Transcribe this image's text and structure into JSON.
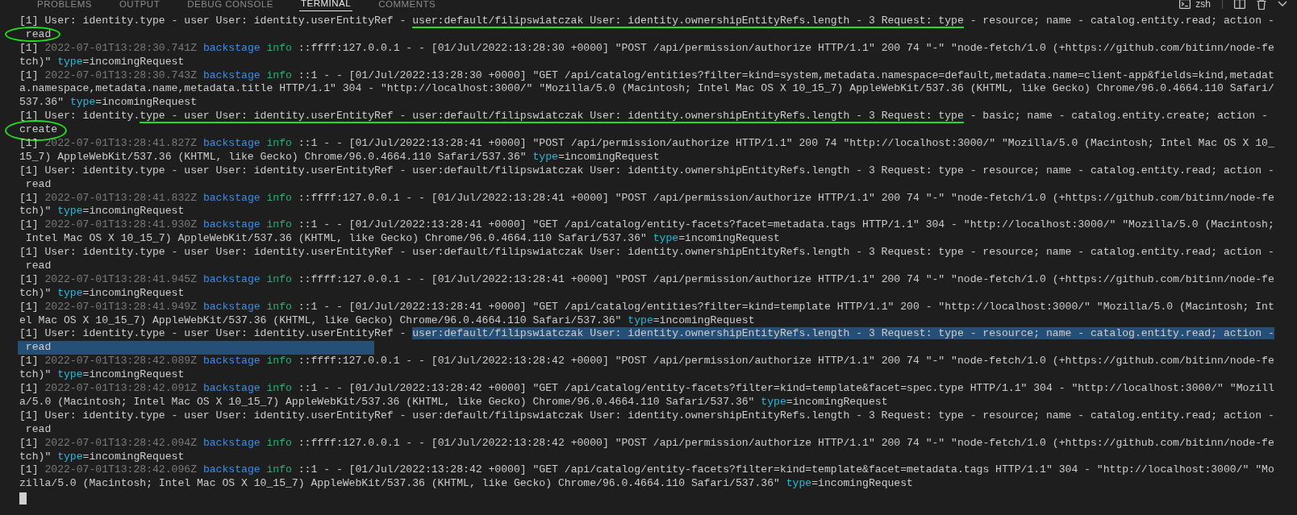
{
  "tabs": [
    {
      "label": "PROBLEMS",
      "selected": false
    },
    {
      "label": "OUTPUT",
      "selected": false
    },
    {
      "label": "DEBUG CONSOLE",
      "selected": false
    },
    {
      "label": "TERMINAL",
      "selected": true
    },
    {
      "label": "COMMENTS",
      "selected": false
    }
  ],
  "shell": {
    "name": "zsh"
  },
  "lines": [
    {
      "segments": [
        {
          "text": "[1] User: identity.type - user User: identity.userEntityRef - ",
          "kind": "plain"
        },
        {
          "text": "user:default/filipswiatczak User: identity.ownershipEntityRefs.length - 3 Request: type",
          "kind": "plain",
          "underlined": true
        },
        {
          "text": " - resource; name - catalog.entity.read; action -",
          "kind": "plain"
        }
      ]
    },
    {
      "segments": [
        {
          "text": " read",
          "kind": "plain",
          "circled": true
        }
      ]
    },
    {
      "segments": [
        {
          "text": "[1] ",
          "kind": "plain"
        },
        {
          "text": "2022-07-01T13:28:30.741Z ",
          "kind": "timestamp"
        },
        {
          "text": "backstage ",
          "kind": "logger"
        },
        {
          "text": "info",
          "kind": "level"
        },
        {
          "text": " ::ffff:127.0.0.1 - - [01/Jul/2022:13:28:30 +0000] \"POST /api/permission/authorize HTTP/1.1\" 200 74 \"-\" \"node-fetch/1.0 (+https://github.com/bitinn/node-fe",
          "kind": "plain"
        }
      ]
    },
    {
      "segments": [
        {
          "text": "tch)\" ",
          "kind": "plain"
        },
        {
          "text": "type",
          "kind": "key"
        },
        {
          "text": "=incomingRequest",
          "kind": "plain"
        }
      ]
    },
    {
      "segments": [
        {
          "text": "[1] ",
          "kind": "plain"
        },
        {
          "text": "2022-07-01T13:28:30.743Z ",
          "kind": "timestamp"
        },
        {
          "text": "backstage ",
          "kind": "logger"
        },
        {
          "text": "info",
          "kind": "level"
        },
        {
          "text": " ::1 - - [01/Jul/2022:13:28:30 +0000] \"GET /api/catalog/entities?filter=kind=system,metadata.namespace=default,metadata.name=client-app&fields=kind,metadat",
          "kind": "plain"
        }
      ]
    },
    {
      "segments": [
        {
          "text": "a.namespace,metadata.name,metadata.title HTTP/1.1\" 304 - \"http://localhost:3000/\" \"Mozilla/5.0 (Macintosh; Intel Mac OS X 10_15_7) AppleWebKit/537.36 (KHTML, like Gecko) Chrome/96.0.4664.110 Safari/",
          "kind": "plain"
        }
      ]
    },
    {
      "segments": [
        {
          "text": "537.36\" ",
          "kind": "plain"
        },
        {
          "text": "type",
          "kind": "key"
        },
        {
          "text": "=incomingRequest",
          "kind": "plain"
        }
      ]
    },
    {
      "segments": [
        {
          "text": "[1] User: identity.",
          "kind": "plain"
        },
        {
          "text": "type - user User: identity.userEntityRef - user:default/filipswiatczak User: identity.ownershipEntityRefs.length - 3 Request: type",
          "kind": "plain",
          "underlined": true
        },
        {
          "text": " - basic; name - catalog.entity.create; action -",
          "kind": "plain"
        }
      ]
    },
    {
      "segments": [
        {
          "text": "create",
          "kind": "plain",
          "circled": true,
          "tall": true
        }
      ]
    },
    {
      "segments": [
        {
          "text": "[1] ",
          "kind": "plain"
        },
        {
          "text": "2022-07-01T13:28:41.827Z ",
          "kind": "timestamp"
        },
        {
          "text": "backstage ",
          "kind": "logger"
        },
        {
          "text": "info",
          "kind": "level"
        },
        {
          "text": " ::1 - - [01/Jul/2022:13:28:41 +0000] \"POST /api/permission/authorize HTTP/1.1\" 200 74 \"http://localhost:3000/\" \"Mozilla/5.0 (Macintosh; Intel Mac OS X 10_",
          "kind": "plain"
        }
      ]
    },
    {
      "segments": [
        {
          "text": "15_7) AppleWebKit/537.36 (KHTML, like Gecko) Chrome/96.0.4664.110 Safari/537.36\" ",
          "kind": "plain"
        },
        {
          "text": "type",
          "kind": "key"
        },
        {
          "text": "=incomingRequest",
          "kind": "plain"
        }
      ]
    },
    {
      "segments": [
        {
          "text": "[1] User: identity.type - user User: identity.userEntityRef - user:default/filipswiatczak User: identity.ownershipEntityRefs.length - 3 Request: type - resource; name - catalog.entity.read; action -",
          "kind": "plain"
        }
      ]
    },
    {
      "segments": [
        {
          "text": " read",
          "kind": "plain"
        }
      ]
    },
    {
      "segments": [
        {
          "text": "[1] ",
          "kind": "plain"
        },
        {
          "text": "2022-07-01T13:28:41.832Z ",
          "kind": "timestamp"
        },
        {
          "text": "backstage ",
          "kind": "logger"
        },
        {
          "text": "info",
          "kind": "level"
        },
        {
          "text": " ::ffff:127.0.0.1 - - [01/Jul/2022:13:28:41 +0000] \"POST /api/permission/authorize HTTP/1.1\" 200 74 \"-\" \"node-fetch/1.0 (+https://github.com/bitinn/node-fe",
          "kind": "plain"
        }
      ]
    },
    {
      "segments": [
        {
          "text": "tch)\" ",
          "kind": "plain"
        },
        {
          "text": "type",
          "kind": "key"
        },
        {
          "text": "=incomingRequest",
          "kind": "plain"
        }
      ]
    },
    {
      "segments": [
        {
          "text": "[1] ",
          "kind": "plain"
        },
        {
          "text": "2022-07-01T13:28:41.930Z ",
          "kind": "timestamp"
        },
        {
          "text": "backstage ",
          "kind": "logger"
        },
        {
          "text": "info",
          "kind": "level"
        },
        {
          "text": " ::1 - - [01/Jul/2022:13:28:41 +0000] \"GET /api/catalog/entity-facets?facet=metadata.tags HTTP/1.1\" 304 - \"http://localhost:3000/\" \"Mozilla/5.0 (Macintosh;",
          "kind": "plain"
        }
      ]
    },
    {
      "segments": [
        {
          "text": " Intel Mac OS X 10_15_7) AppleWebKit/537.36 (KHTML, like Gecko) Chrome/96.0.4664.110 Safari/537.36\" ",
          "kind": "plain"
        },
        {
          "text": "type",
          "kind": "key"
        },
        {
          "text": "=incomingRequest",
          "kind": "plain"
        }
      ]
    },
    {
      "segments": [
        {
          "text": "[1] User: identity.type - user User: identity.userEntityRef - user:default/filipswiatczak User: identity.ownershipEntityRefs.length - 3 Request: type - resource; name - catalog.entity.read; action -",
          "kind": "plain"
        }
      ]
    },
    {
      "segments": [
        {
          "text": " read",
          "kind": "plain"
        }
      ]
    },
    {
      "segments": [
        {
          "text": "[1] ",
          "kind": "plain"
        },
        {
          "text": "2022-07-01T13:28:41.945Z ",
          "kind": "timestamp"
        },
        {
          "text": "backstage ",
          "kind": "logger"
        },
        {
          "text": "info",
          "kind": "level"
        },
        {
          "text": " ::ffff:127.0.0.1 - - [01/Jul/2022:13:28:41 +0000] \"POST /api/permission/authorize HTTP/1.1\" 200 74 \"-\" \"node-fetch/1.0 (+https://github.com/bitinn/node-fe",
          "kind": "plain"
        }
      ]
    },
    {
      "segments": [
        {
          "text": "tch)\" ",
          "kind": "plain"
        },
        {
          "text": "type",
          "kind": "key"
        },
        {
          "text": "=incomingRequest",
          "kind": "plain"
        }
      ]
    },
    {
      "segments": [
        {
          "text": "[1] ",
          "kind": "plain"
        },
        {
          "text": "2022-07-01T13:28:41.949Z ",
          "kind": "timestamp"
        },
        {
          "text": "backstage ",
          "kind": "logger"
        },
        {
          "text": "info",
          "kind": "level"
        },
        {
          "text": " ::1 - - [01/Jul/2022:13:28:41 +0000] \"GET /api/catalog/entities?filter=kind=template HTTP/1.1\" 200 - \"http://localhost:3000/\" \"Mozilla/5.0 (Macintosh; Int",
          "kind": "plain"
        }
      ]
    },
    {
      "segments": [
        {
          "text": "el Mac OS X 10_15_7) AppleWebKit/537.36 (KHTML, like Gecko) Chrome/96.0.4664.110 Safari/537.36\" ",
          "kind": "plain"
        },
        {
          "text": "type",
          "kind": "key"
        },
        {
          "text": "=incomingRequest",
          "kind": "plain"
        }
      ]
    },
    {
      "segments": [
        {
          "text": "[1] User: identity.type - user User: identity.userEntityRef - ",
          "kind": "plain"
        },
        {
          "text": "user:default/filipswiatczak User: identity.ownershipEntityRefs.length - 3 Request: type - resource; name - catalog.entity.read; action -",
          "kind": "plain",
          "selected": true
        }
      ]
    },
    {
      "segments": [
        {
          "text": " read",
          "kind": "plain",
          "selected": true,
          "wide": true
        }
      ]
    },
    {
      "segments": [
        {
          "text": "[1] ",
          "kind": "plain"
        },
        {
          "text": "2022-07-01T13:28:42.089Z ",
          "kind": "timestamp"
        },
        {
          "text": "backstage ",
          "kind": "logger"
        },
        {
          "text": "info",
          "kind": "level"
        },
        {
          "text": " ::ffff:127.0.0.1 - - [01/Jul/2022:13:28:42 +0000] \"POST /api/permission/authorize HTTP/1.1\" 200 74 \"-\" \"node-fetch/1.0 (+https://github.com/bitinn/node-fe",
          "kind": "plain"
        }
      ]
    },
    {
      "segments": [
        {
          "text": "tch)\" ",
          "kind": "plain"
        },
        {
          "text": "type",
          "kind": "key"
        },
        {
          "text": "=incomingRequest",
          "kind": "plain"
        }
      ]
    },
    {
      "segments": [
        {
          "text": "[1] ",
          "kind": "plain"
        },
        {
          "text": "2022-07-01T13:28:42.091Z ",
          "kind": "timestamp"
        },
        {
          "text": "backstage ",
          "kind": "logger"
        },
        {
          "text": "info",
          "kind": "level"
        },
        {
          "text": " ::1 - - [01/Jul/2022:13:28:42 +0000] \"GET /api/catalog/entity-facets?filter=kind=template&facet=spec.type HTTP/1.1\" 304 - \"http://localhost:3000/\" \"Mozill",
          "kind": "plain"
        }
      ]
    },
    {
      "segments": [
        {
          "text": "a/5.0 (Macintosh; Intel Mac OS X 10_15_7) AppleWebKit/537.36 (KHTML, like Gecko) Chrome/96.0.4664.110 Safari/537.36\" ",
          "kind": "plain"
        },
        {
          "text": "type",
          "kind": "key"
        },
        {
          "text": "=incomingRequest",
          "kind": "plain"
        }
      ]
    },
    {
      "segments": [
        {
          "text": "[1] User: identity.type - user User: identity.userEntityRef - user:default/filipswiatczak User: identity.ownershipEntityRefs.length - 3 Request: type - resource; name - catalog.entity.read; action -",
          "kind": "plain"
        }
      ]
    },
    {
      "segments": [
        {
          "text": " read",
          "kind": "plain"
        }
      ]
    },
    {
      "segments": [
        {
          "text": "[1] ",
          "kind": "plain"
        },
        {
          "text": "2022-07-01T13:28:42.094Z ",
          "kind": "timestamp"
        },
        {
          "text": "backstage ",
          "kind": "logger"
        },
        {
          "text": "info",
          "kind": "level"
        },
        {
          "text": " ::ffff:127.0.0.1 - - [01/Jul/2022:13:28:42 +0000] \"POST /api/permission/authorize HTTP/1.1\" 200 74 \"-\" \"node-fetch/1.0 (+https://github.com/bitinn/node-fe",
          "kind": "plain"
        }
      ]
    },
    {
      "segments": [
        {
          "text": "tch)\" ",
          "kind": "plain"
        },
        {
          "text": "type",
          "kind": "key"
        },
        {
          "text": "=incomingRequest",
          "kind": "plain"
        }
      ]
    },
    {
      "segments": [
        {
          "text": "[1] ",
          "kind": "plain"
        },
        {
          "text": "2022-07-01T13:28:42.096Z ",
          "kind": "timestamp"
        },
        {
          "text": "backstage ",
          "kind": "logger"
        },
        {
          "text": "info",
          "kind": "level"
        },
        {
          "text": " ::1 - - [01/Jul/2022:13:28:42 +0000] \"GET /api/catalog/entity-facets?filter=kind=template&facet=metadata.tags HTTP/1.1\" 304 - \"http://localhost:3000/\" \"Mo",
          "kind": "plain"
        }
      ]
    },
    {
      "segments": [
        {
          "text": "zilla/5.0 (Macintosh; Intel Mac OS X 10_15_7) AppleWebKit/537.36 (KHTML, like Gecko) Chrome/96.0.4664.110 Safari/537.36\" ",
          "kind": "plain"
        },
        {
          "text": "type",
          "kind": "key"
        },
        {
          "text": "=incomingRequest",
          "kind": "plain"
        }
      ]
    }
  ]
}
